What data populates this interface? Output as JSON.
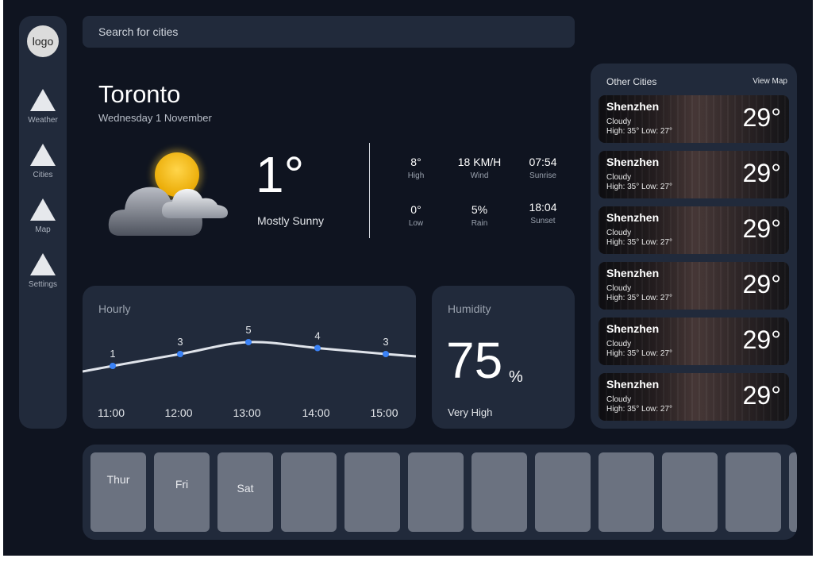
{
  "sidebar": {
    "logo": "logo",
    "items": [
      {
        "label": "Weather"
      },
      {
        "label": "Cities"
      },
      {
        "label": "Map"
      },
      {
        "label": "Settings"
      }
    ]
  },
  "search": {
    "placeholder": "Search for cities"
  },
  "current": {
    "city": "Toronto",
    "date": "Wednesday 1 November",
    "temp": "1°",
    "condition": "Mostly Sunny",
    "icon": "partly-cloudy-icon",
    "stats": [
      {
        "value": "8°",
        "label": "High"
      },
      {
        "value": "18 KM/H",
        "label": "Wind"
      },
      {
        "value": "07:54",
        "label": "Sunrise"
      },
      {
        "value": "0°",
        "label": "Low"
      },
      {
        "value": "5%",
        "label": "Rain"
      },
      {
        "value": "18:04",
        "label": "Sunset"
      }
    ]
  },
  "hourly": {
    "title": "Hourly",
    "chart_data": {
      "type": "line",
      "categories": [
        "11:00",
        "12:00",
        "13:00",
        "14:00",
        "15:00"
      ],
      "values": [
        1,
        3,
        5,
        4,
        3
      ],
      "value_labels": [
        "1",
        "3",
        "5",
        "4",
        "3"
      ],
      "line_color": "#dfe3ea",
      "point_color": "#3b82f6"
    }
  },
  "humidity": {
    "title": "Humidity",
    "value": "75",
    "unit": "%",
    "description": "Very High"
  },
  "other_cities": {
    "title": "Other Cities",
    "view_map": "View Map",
    "cities": [
      {
        "name": "Shenzhen",
        "condition": "Cloudy",
        "high_low": "High: 35°  Low: 27°",
        "temp": "29°"
      },
      {
        "name": "Shenzhen",
        "condition": "Cloudy",
        "high_low": "High: 35°  Low: 27°",
        "temp": "29°"
      },
      {
        "name": "Shenzhen",
        "condition": "Cloudy",
        "high_low": "High: 35°  Low: 27°",
        "temp": "29°"
      },
      {
        "name": "Shenzhen",
        "condition": "Cloudy",
        "high_low": "High: 35°  Low: 27°",
        "temp": "29°"
      },
      {
        "name": "Shenzhen",
        "condition": "Cloudy",
        "high_low": "High: 35°  Low: 27°",
        "temp": "29°"
      },
      {
        "name": "Shenzhen",
        "condition": "Cloudy",
        "high_low": "High: 35°  Low: 27°",
        "temp": "29°"
      }
    ]
  },
  "forecast": {
    "days": [
      {
        "label": "Thur"
      },
      {
        "label": "Fri"
      },
      {
        "label": "Sat"
      },
      {
        "label": ""
      },
      {
        "label": ""
      },
      {
        "label": ""
      },
      {
        "label": ""
      },
      {
        "label": ""
      },
      {
        "label": ""
      },
      {
        "label": ""
      },
      {
        "label": ""
      },
      {
        "label": ""
      }
    ]
  },
  "colors": {
    "background": "#0f1420",
    "panel": "#212a3b",
    "accent": "#3b82f6",
    "day_card": "#6b7280"
  }
}
